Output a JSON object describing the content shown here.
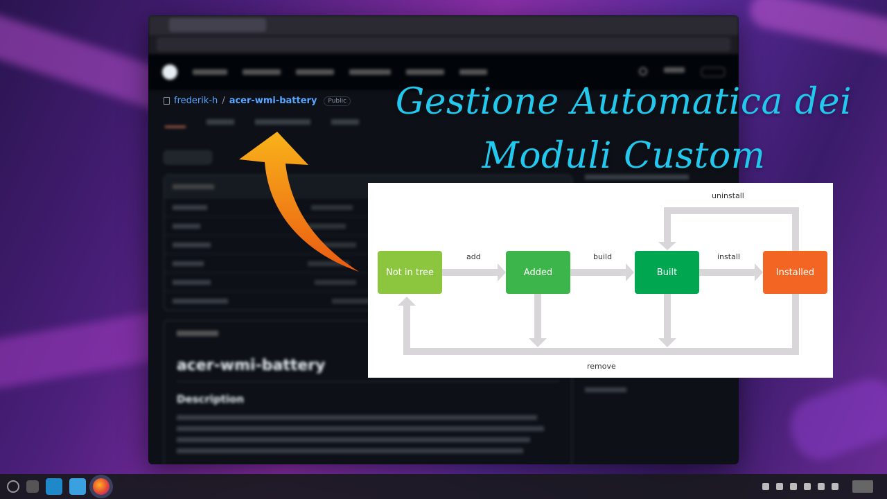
{
  "title": {
    "line1": "Gestione Automatica dei",
    "line2": "Moduli Custom"
  },
  "repo": {
    "owner": "frederik-h",
    "separator": "/",
    "name": "acer-wmi-battery",
    "visibility": "Public"
  },
  "diagram": {
    "nodes": [
      {
        "label": "Not in tree",
        "color": "#8cc63f"
      },
      {
        "label": "Added",
        "color": "#3cb54a"
      },
      {
        "label": "Built",
        "color": "#00a650"
      },
      {
        "label": "Installed",
        "color": "#f26522"
      }
    ],
    "edges": {
      "add": "add",
      "build": "build",
      "install": "install",
      "uninstall": "uninstall",
      "remove": "remove"
    },
    "arrow_color": "#d9d6d9"
  },
  "colors": {
    "title": "#22c8ee",
    "link": "#58a6ff",
    "pointer_arrow_top": "#f9b31a",
    "pointer_arrow_bottom": "#ea5a12"
  },
  "background_window": {
    "readme_title": "acer-wmi-battery",
    "readme_heading": "Description",
    "icons": [
      "github-logo-icon",
      "repo-icon",
      "firefox-icon",
      "folder-icon",
      "terminal-icon"
    ]
  }
}
